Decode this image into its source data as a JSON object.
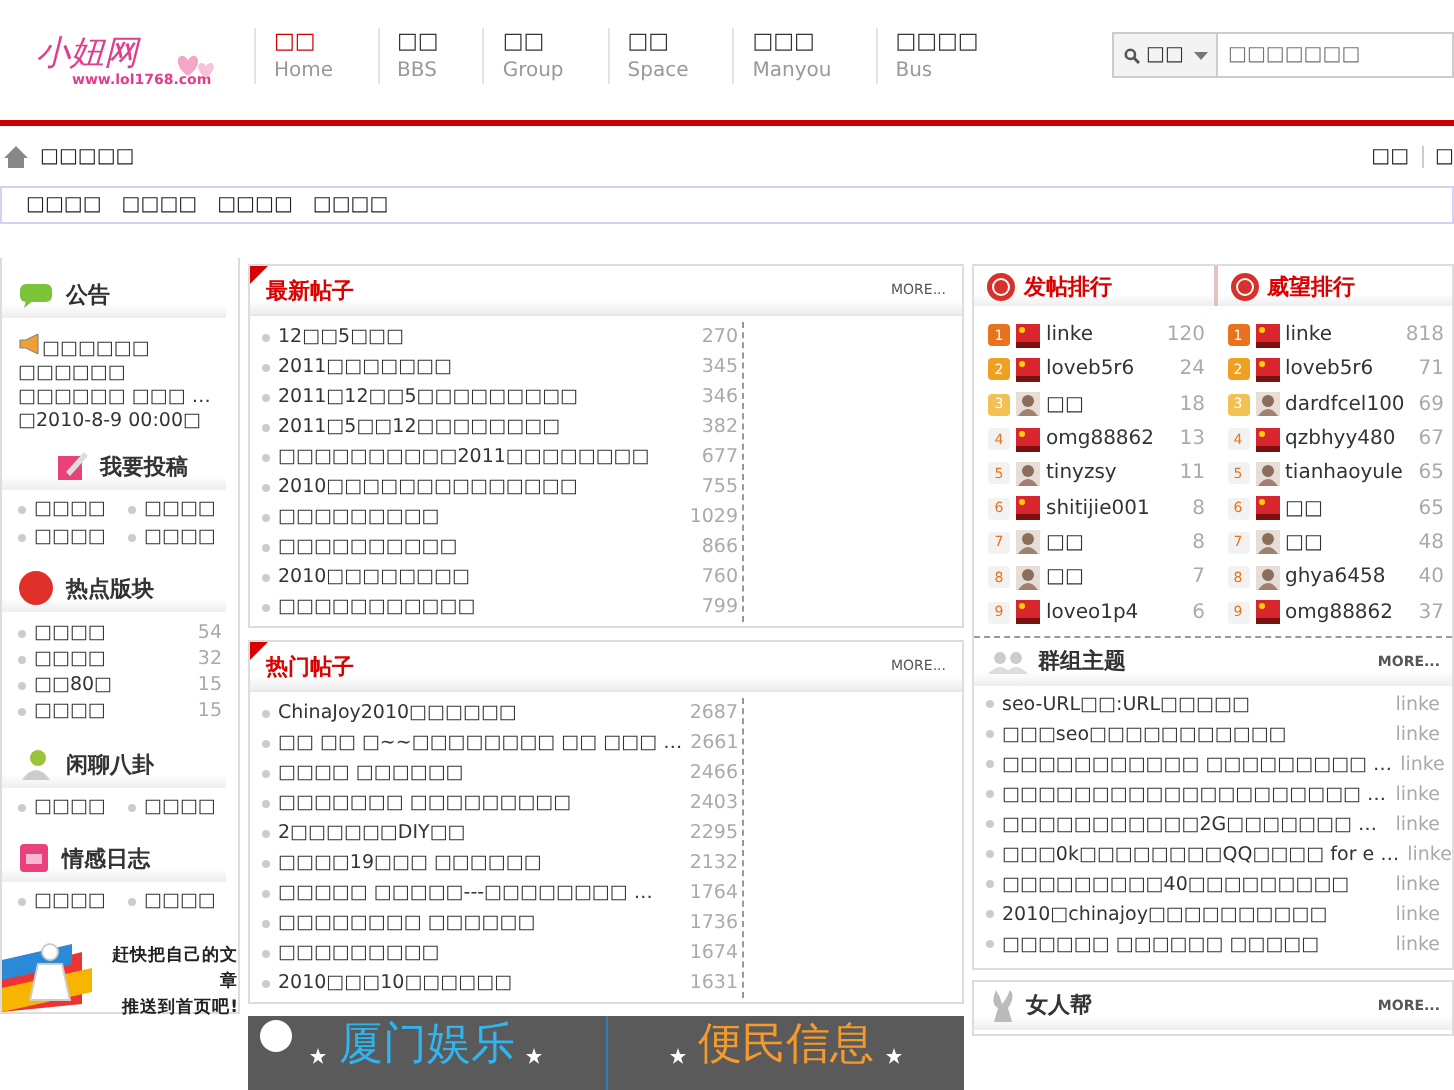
{
  "header": {
    "logo": {
      "title": "小妞网",
      "url": "www.lol1768.com"
    },
    "nav": [
      {
        "label": "□□",
        "sub": "Home",
        "selected": true
      },
      {
        "label": "□□",
        "sub": "BBS",
        "selected": false
      },
      {
        "label": "□□",
        "sub": "Group",
        "selected": false
      },
      {
        "label": "□□",
        "sub": "Space",
        "selected": false
      },
      {
        "label": "□□□",
        "sub": "Manyou",
        "selected": false
      },
      {
        "label": "□□□□",
        "sub": "Bus",
        "selected": false
      }
    ],
    "search": {
      "scope": "□□",
      "placeholder": "□□□□□□□"
    }
  },
  "breadcrumb": {
    "text": "□□□□□",
    "links": [
      "□□",
      "□"
    ]
  },
  "subnav": [
    "□□□□",
    "□□□□",
    "□□□□",
    "□□□□"
  ],
  "left": {
    "notice": {
      "title": "公告",
      "text": "□□□□□□ □□□□□□ □□□□□□ □□□ …□2010-8-9 00:00□"
    },
    "submit": {
      "title": "我要投稿",
      "links": [
        "□□□□",
        "□□□□",
        "□□□□",
        "□□□□"
      ]
    },
    "hot": {
      "title": "热点版块",
      "items": [
        {
          "label": "□□□□",
          "count": "54"
        },
        {
          "label": "□□□□",
          "count": "32"
        },
        {
          "label": "□□80□",
          "count": "15"
        },
        {
          "label": "□□□□",
          "count": "15"
        }
      ]
    },
    "gossip": {
      "title": "闲聊八卦",
      "links": [
        "□□□□",
        "□□□□"
      ]
    },
    "diary": {
      "title": "情感日志",
      "links": [
        "□□□□",
        "□□□□"
      ]
    },
    "promo": [
      "赶快把自己的文章",
      "推送到首页吧!"
    ]
  },
  "middle": {
    "panels": [
      {
        "title": "最新帖子",
        "more": "MORE...",
        "rows": [
          {
            "title": "12□□5□□□",
            "count": "270"
          },
          {
            "title": "2011□□□□□□□",
            "count": "345"
          },
          {
            "title": "2011□12□□5□□□□□□□□□",
            "count": "346"
          },
          {
            "title": "2011□5□□12□□□□□□□□",
            "count": "382"
          },
          {
            "title": "□□□□□□□□□□2011□□□□□□□□",
            "count": "677"
          },
          {
            "title": "2010□□□□□□□□□□□□□□",
            "count": "755"
          },
          {
            "title": "□□□□□□□□□",
            "count": "1029"
          },
          {
            "title": "□□□□□□□□□□",
            "count": "866"
          },
          {
            "title": "2010□□□□□□□□",
            "count": "760"
          },
          {
            "title": "□□□□□□□□□□□",
            "count": "799"
          }
        ]
      },
      {
        "title": "热门帖子",
        "more": "MORE...",
        "rows": [
          {
            "title": "ChinaJoy2010□□□□□□",
            "count": "2687"
          },
          {
            "title": "□□ □□ □~~□□□□□□□□ □□ □□□ …",
            "count": "2661"
          },
          {
            "title": "□□□□ □□□□□□",
            "count": "2466"
          },
          {
            "title": "□□□□□□□ □□□□□□□□□",
            "count": "2403"
          },
          {
            "title": "2□□□□□□DIY□□",
            "count": "2295"
          },
          {
            "title": "□□□□19□□□ □□□□□□",
            "count": "2132"
          },
          {
            "title": "□□□□□ □□□□□---□□□□□□□□ …",
            "count": "1764"
          },
          {
            "title": "□□□□□□□□ □□□□□□",
            "count": "1736"
          },
          {
            "title": "□□□□□□□□□",
            "count": "1674"
          },
          {
            "title": "2010□□□10□□□□□□",
            "count": "1631"
          }
        ]
      }
    ],
    "banner": [
      "厦门娱乐",
      "便民信息"
    ]
  },
  "right": {
    "rankings": [
      {
        "title": "发帖排行",
        "rows": [
          {
            "rank": "1",
            "name": "linke",
            "count": "120"
          },
          {
            "rank": "2",
            "name": "loveb5r6",
            "count": "24"
          },
          {
            "rank": "3",
            "name": "□□",
            "count": "18"
          },
          {
            "rank": "4",
            "name": "omg88862",
            "count": "13"
          },
          {
            "rank": "5",
            "name": "tinyzsy",
            "count": "11"
          },
          {
            "rank": "6",
            "name": "shitijie001",
            "count": "8"
          },
          {
            "rank": "7",
            "name": "□□",
            "count": "8"
          },
          {
            "rank": "8",
            "name": "□□",
            "count": "7"
          },
          {
            "rank": "9",
            "name": "loveo1p4",
            "count": "6"
          }
        ]
      },
      {
        "title": "威望排行",
        "rows": [
          {
            "rank": "1",
            "name": "linke",
            "count": "818"
          },
          {
            "rank": "2",
            "name": "loveb5r6",
            "count": "71"
          },
          {
            "rank": "3",
            "name": "dardfcel100",
            "count": "69"
          },
          {
            "rank": "4",
            "name": "qzbhyy480",
            "count": "67"
          },
          {
            "rank": "5",
            "name": "tianhaoyule",
            "count": "65"
          },
          {
            "rank": "6",
            "name": "□□",
            "count": "65"
          },
          {
            "rank": "7",
            "name": "□□",
            "count": "48"
          },
          {
            "rank": "8",
            "name": "ghya6458",
            "count": "40"
          },
          {
            "rank": "9",
            "name": "omg88862",
            "count": "37"
          }
        ]
      }
    ],
    "groups": {
      "title": "群组主题",
      "more": "MORE...",
      "rows": [
        {
          "title": "seo-URL□□:URL□□□□□",
          "author": "linke"
        },
        {
          "title": "□□□seo□□□□□□□□□□□",
          "author": "linke"
        },
        {
          "title": "□□□□□□□□□□□ □□□□□□□□□ …",
          "author": "linke"
        },
        {
          "title": "□□□□□□□□□□□□□□□□□□□□ …",
          "author": "linke"
        },
        {
          "title": "□□□□□□□□□□□2G□□□□□□□ …",
          "author": "linke"
        },
        {
          "title": "□□□0k□□□□□□□□QQ□□□□ for e …",
          "author": "linke"
        },
        {
          "title": "□□□□□□□□□40□□□□□□□□□",
          "author": "linke"
        },
        {
          "title": "2010□chinajoy□□□□□□□□□□",
          "author": "linke"
        },
        {
          "title": "□□□□□□ □□□□□□ □□□□□",
          "author": "linke"
        }
      ]
    },
    "women": {
      "title": "女人帮",
      "more": "MORE..."
    }
  }
}
